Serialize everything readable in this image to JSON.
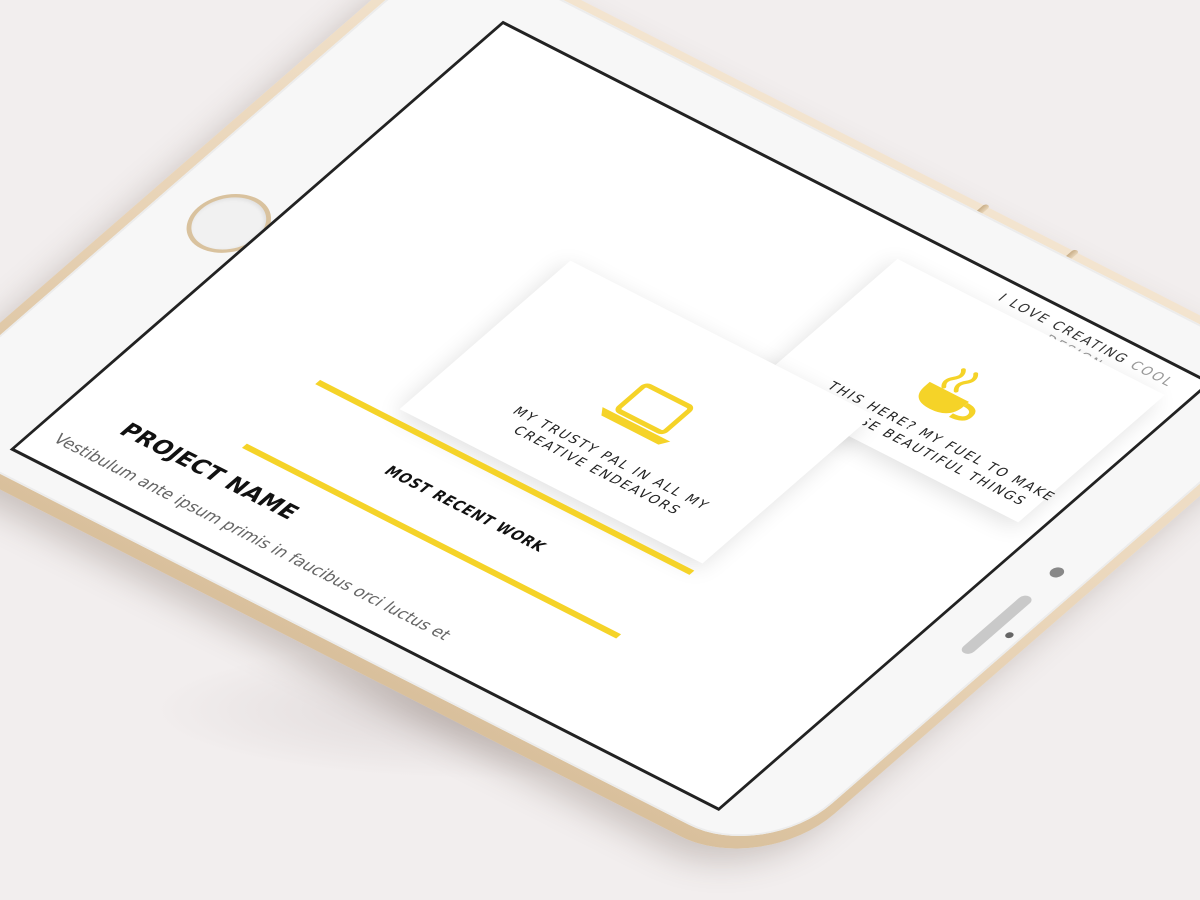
{
  "screen": {
    "intro_line_1": "I love creating",
    "intro_line_1_tail": "cool design",
    "intro_line_2": "I love creating cool stuff",
    "arrow_glyph": "↓",
    "coffee_caption_1": "This here? My fuel to make",
    "coffee_caption_2": "those beautiful things",
    "laptop_caption_1": "My trusty pal in all my",
    "laptop_caption_2": "creative endeavors",
    "section_title": "Most recent work",
    "project_name": "Project name",
    "project_description": "Vestibulum ante ipsum primis in faucibus orci luctus et"
  },
  "icons": {
    "coffee": "coffee-cup-icon",
    "laptop": "laptop-icon"
  },
  "colors": {
    "accent": "#f5d328",
    "background": "#f2eeee",
    "phone_gold": "#e8d3b6",
    "screen_bg": "#ffffff"
  }
}
